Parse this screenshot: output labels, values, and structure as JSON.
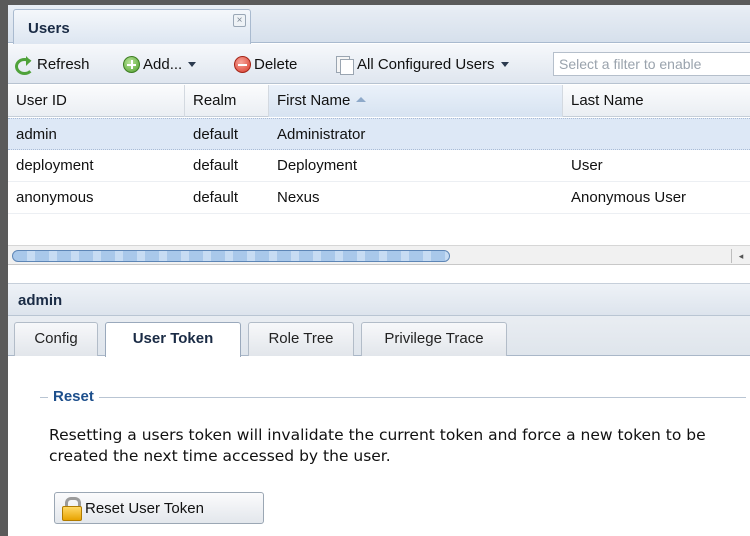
{
  "window": {
    "tab_title": "Users",
    "close_glyph": "×"
  },
  "toolbar": {
    "refresh_label": "Refresh",
    "add_label": "Add...",
    "delete_label": "Delete",
    "source_label": "All Configured Users",
    "filter_placeholder": "Select a filter to enable"
  },
  "grid": {
    "columns": [
      "User ID",
      "Realm",
      "First Name",
      "Last Name"
    ],
    "sorted_column": "First Name",
    "sort_direction": "ascending",
    "rows": [
      {
        "user_id": "admin",
        "realm": "default",
        "first_name": "Administrator",
        "last_name": ""
      },
      {
        "user_id": "deployment",
        "realm": "default",
        "first_name": "Deployment",
        "last_name": "User"
      },
      {
        "user_id": "anonymous",
        "realm": "default",
        "first_name": "Nexus",
        "last_name": "Anonymous User"
      }
    ],
    "selected_row": 0,
    "scroll_left_glyph": "◂"
  },
  "detail": {
    "title": "admin",
    "tabs": [
      "Config",
      "User Token",
      "Role Tree",
      "Privilege Trace"
    ],
    "active_tab": "User Token",
    "section_legend": "Reset",
    "description": "Resetting a users token will invalidate the current token and force a new token to be created the next time accessed by the user.",
    "reset_button_label": "Reset User Token"
  },
  "icons": {
    "refresh": "refresh-icon",
    "add": "add-icon",
    "delete": "delete-icon",
    "users": "users-list-icon",
    "lock": "lock-icon"
  }
}
